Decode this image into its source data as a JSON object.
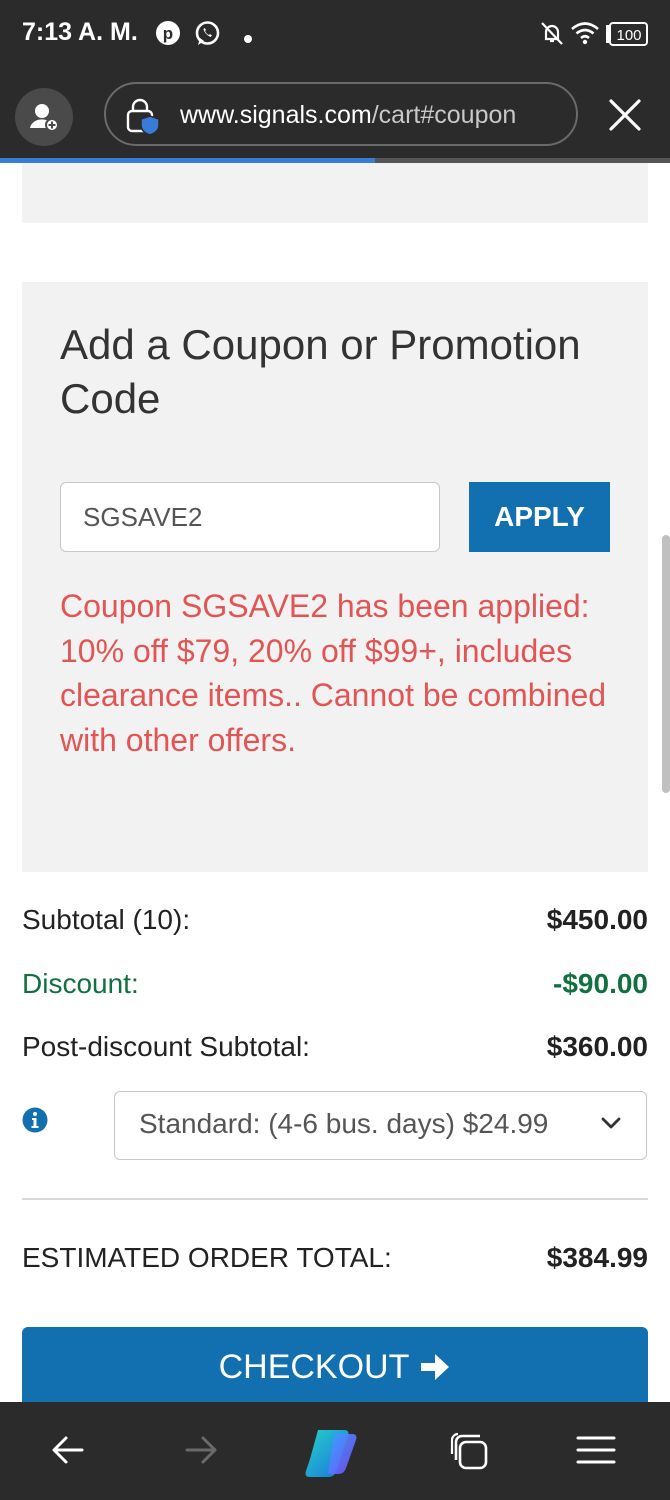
{
  "status_bar": {
    "time": "7:13 A. M.",
    "battery": "100",
    "icons": [
      "pinterest-icon",
      "whatsapp-icon",
      "notification-dot-icon",
      "bell-off-icon",
      "wifi-icon",
      "battery-icon"
    ]
  },
  "browser": {
    "url_domain": "www.signals.com",
    "url_path": "/cart#coupon",
    "page_load_progress": 0.56
  },
  "coupon": {
    "heading": "Add a Coupon or Promotion Code",
    "code_value": "SGSAVE2",
    "apply_label": "APPLY",
    "message": "Coupon SGSAVE2 has been applied: 10% off $79, 20% off $99+, includes clearance items.. Cannot be combined with other offers."
  },
  "summary": {
    "subtotal_label": "Subtotal (10):",
    "subtotal_value": "$450.00",
    "discount_label": "Discount:",
    "discount_value": "-$90.00",
    "post_label": "Post-discount Subtotal:",
    "post_value": "$360.00",
    "shipping_option": "Standard: (4-6 bus. days) $24.99",
    "total_label": "ESTIMATED ORDER TOTAL:",
    "total_value": "$384.99"
  },
  "checkout": {
    "label": "CHECKOUT"
  },
  "colors": {
    "accent_blue": "#126fb0",
    "error_red": "#e25555",
    "discount_green": "#11703f",
    "chrome_dark": "#2b2b2b"
  }
}
